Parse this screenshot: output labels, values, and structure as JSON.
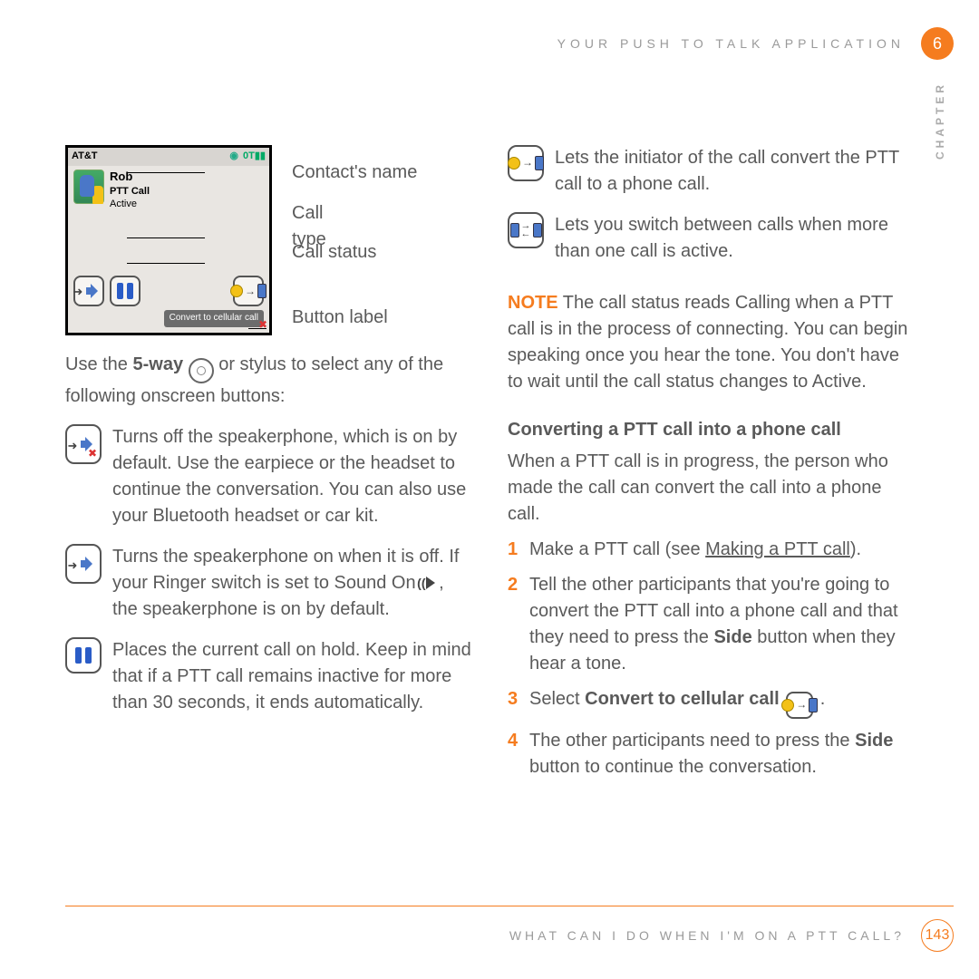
{
  "header": {
    "section": "YOUR PUSH TO TALK APPLICATION",
    "chapter_num": "6",
    "chapter_label": "CHAPTER"
  },
  "phone": {
    "carrier": "AT&T",
    "clock_icon": "◉",
    "network": "0T▮▮",
    "contact_name": "Rob",
    "call_type": "PTT Call",
    "call_status": "Active",
    "tooltip": "Convert to cellular call"
  },
  "callouts": {
    "name": "Contact's name",
    "type": "Call type",
    "status": "Call status",
    "button": "Button label"
  },
  "intro_pre": "Use the ",
  "intro_bold": "5-way",
  "intro_post": " or stylus to select any of the following onscreen buttons:",
  "icons": {
    "spk_off": "Turns off the speakerphone, which is on by default. Use the earpiece or the headset to continue the conversation. You can also use your Bluetooth headset or car kit.",
    "spk_on_a": "Turns the speakerphone on when it is off. If your Ringer switch is set to Sound On ",
    "spk_on_b": ", the speakerphone is on by default.",
    "hold": "Places the current call on hold. Keep in mind that if a PTT call remains inactive for more than 30 seconds, it ends automatically.",
    "convert": "Lets the initiator of the call convert the PTT call to a phone call.",
    "switch": "Lets you switch between calls when more than one call is active."
  },
  "note": {
    "label": "NOTE",
    "text": "  The call status reads Calling when a PTT call is in the process of connecting. You can begin speaking once you hear the tone. You don't have to wait until the call status changes to Active."
  },
  "subhead": "Converting a PTT call into a phone call",
  "subhead_intro": "When a PTT call is in progress, the person who made the call can convert the call into a phone call.",
  "steps": {
    "s1a": "Make a PTT call (see ",
    "s1link": "Making a PTT call",
    "s1b": ").",
    "s2a": "Tell the other participants that you're going to convert the PTT call into a phone call and that they need to press the ",
    "s2bold": "Side",
    "s2b": " button when they hear a tone.",
    "s3a": "Select ",
    "s3bold": "Convert to cellular call",
    "s3b": " .",
    "s4a": "The other participants need to press the ",
    "s4bold": "Side",
    "s4b": " button to continue the conversation."
  },
  "footer": {
    "text": "WHAT CAN I DO WHEN I'M ON A PTT CALL?",
    "page": "143"
  }
}
